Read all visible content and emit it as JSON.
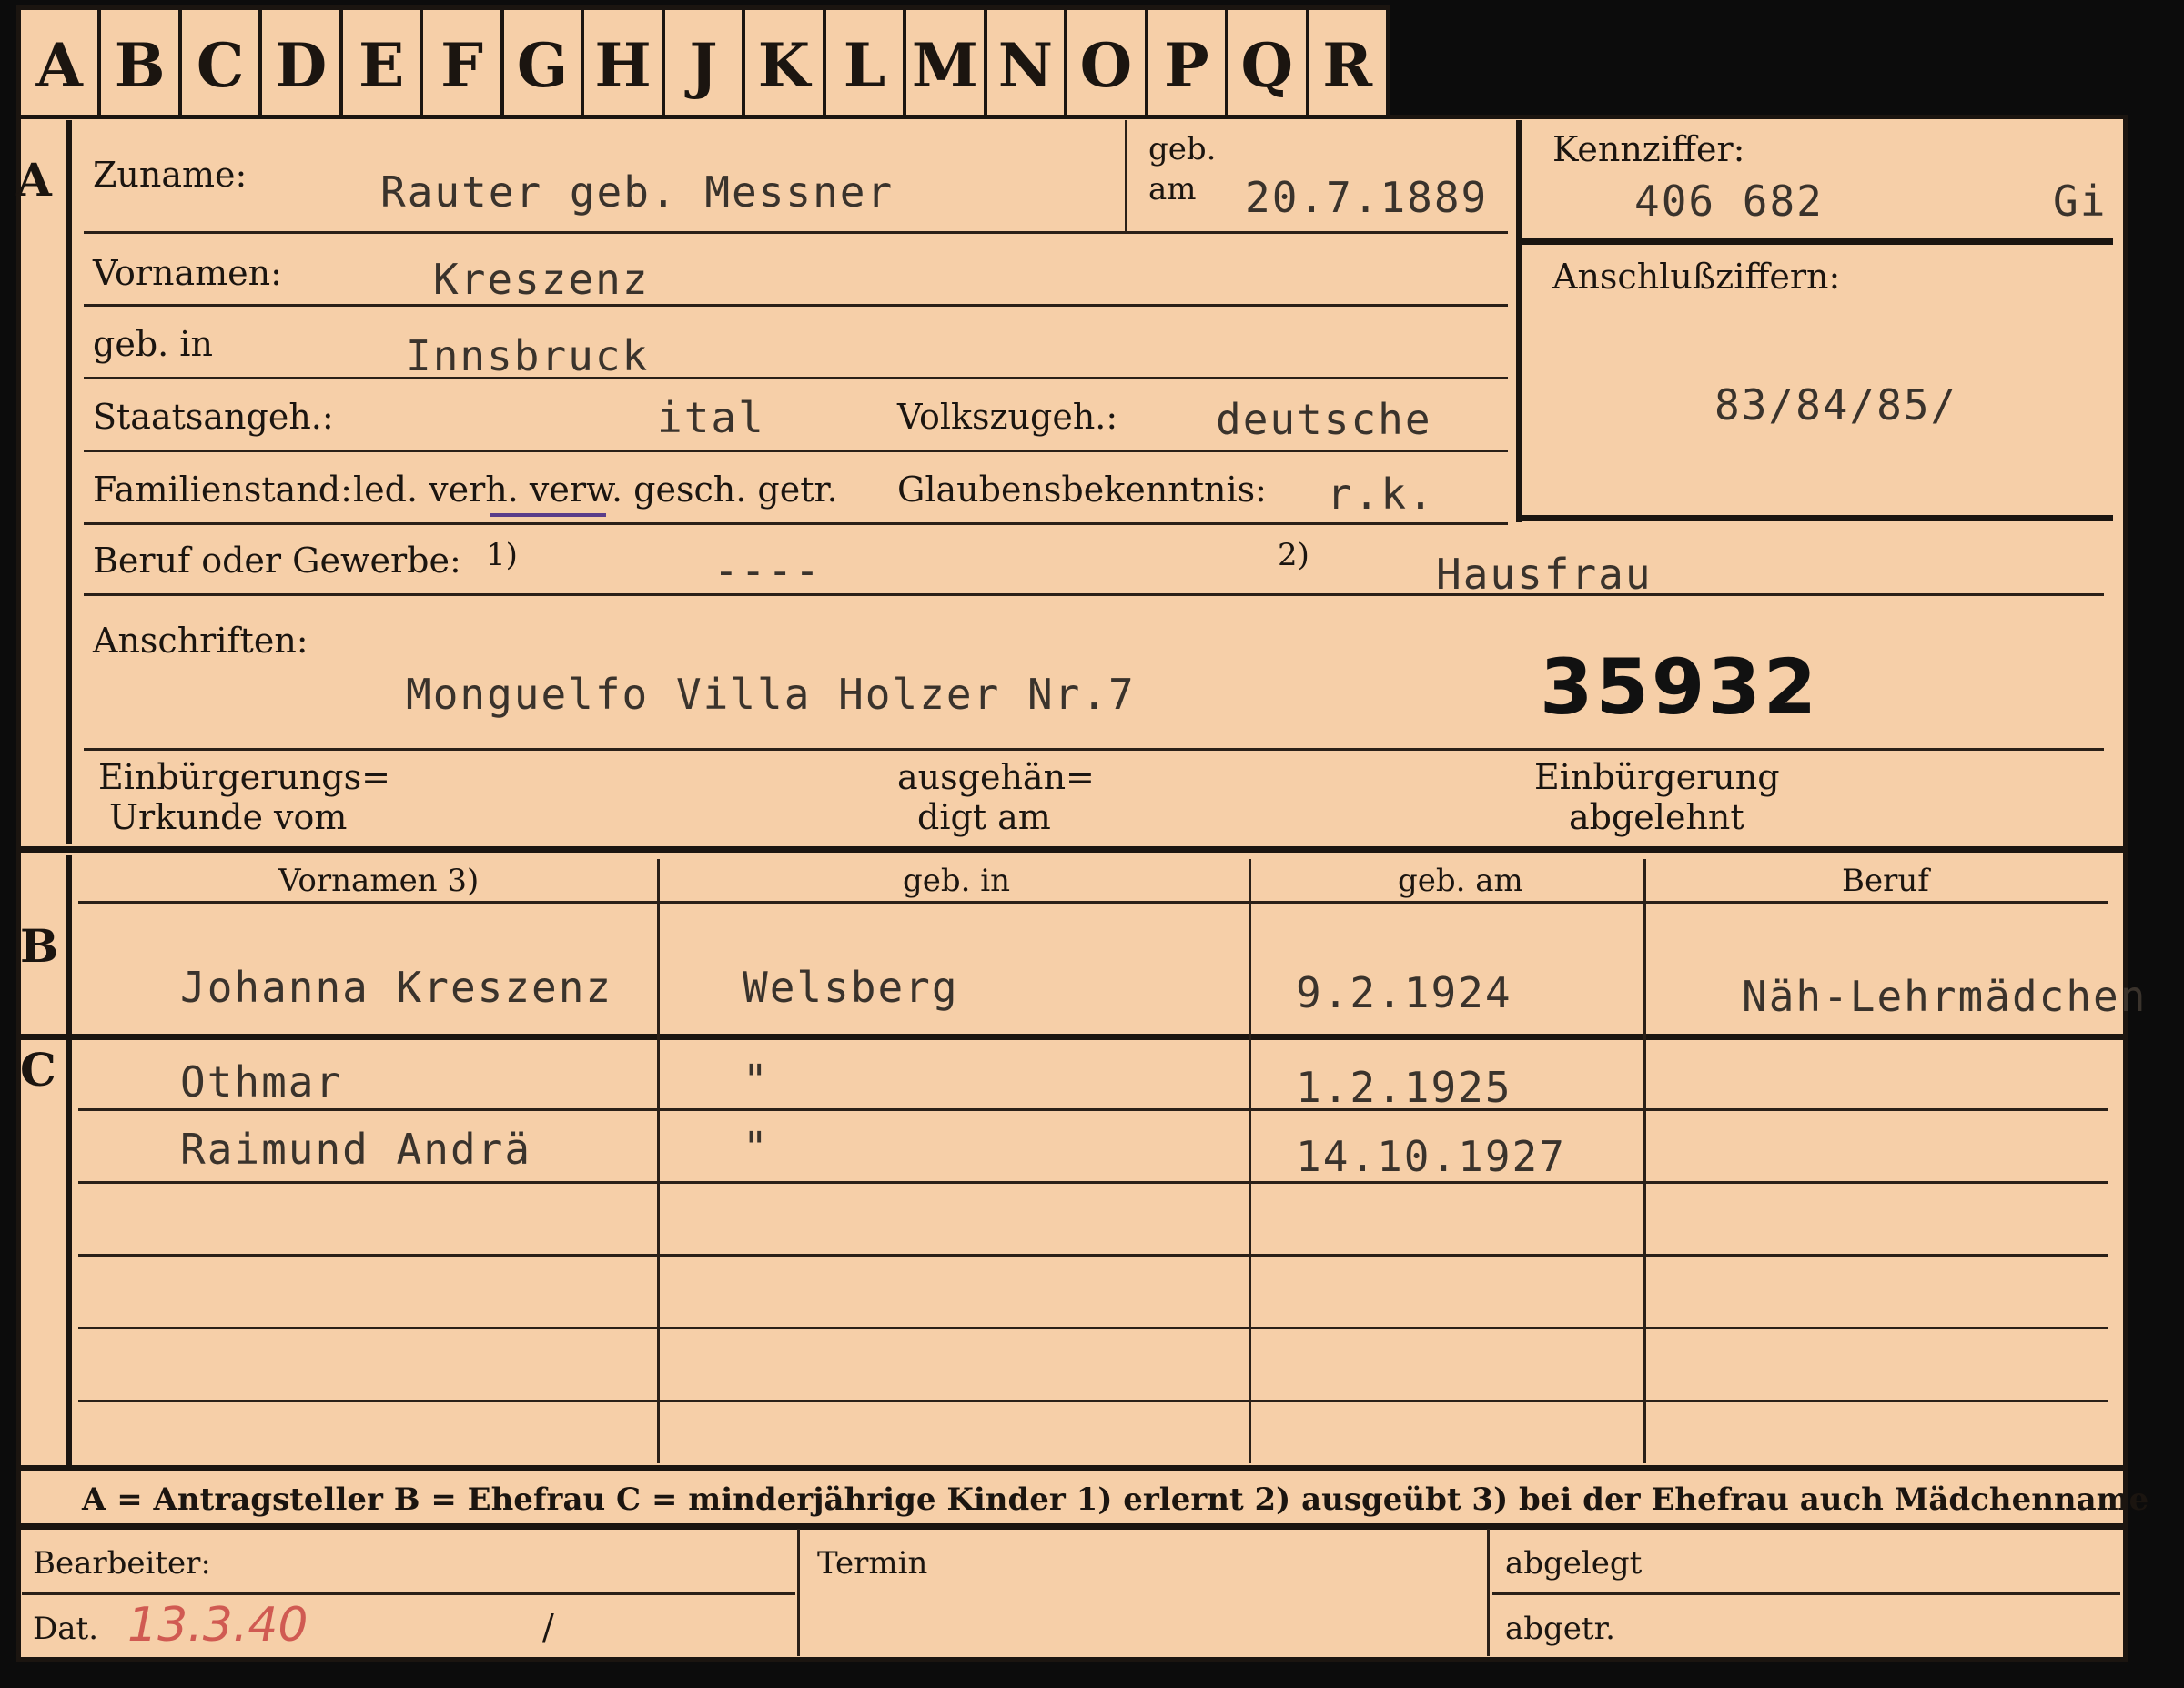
{
  "tabs": [
    "A",
    "B",
    "C",
    "D",
    "E",
    "F",
    "G",
    "H",
    "J",
    "K",
    "L",
    "M",
    "N",
    "O",
    "P",
    "Q",
    "R"
  ],
  "section_a": {
    "marker": "A",
    "zuname_label": "Zuname:",
    "zuname": "Rauter geb. Messner",
    "geb_am_label1": "geb.",
    "geb_am_label2": "am",
    "geb_am": "20.7.1889",
    "kennziffer_label": "Kennziffer:",
    "kennziffer": "406 682",
    "kennziffer_suffix": "Gi",
    "anschluss_label": "Anschlußziffern:",
    "anschluss": "83/84/85/",
    "vornamen_label": "Vornamen:",
    "vornamen": "Kreszenz",
    "geb_in_label": "geb. in",
    "geb_in": "Innsbruck",
    "staatsangeh_label": "Staatsangeh.:",
    "staatsangeh": "ital",
    "volkszugeh_label": "Volkszugeh.:",
    "volkszugeh": "deutsche",
    "familienstand_label": "Familienstand:",
    "familienstand_options": "led. verh. verw. gesch. getr.",
    "glaubens_label": "Glaubensbekenntnis:",
    "glaubens": "r.k.",
    "beruf_label": "Beruf oder Gewerbe:",
    "beruf_fn1": "1)",
    "beruf_1": "----",
    "beruf_fn2": "2)",
    "beruf_2": "Hausfrau",
    "anschriften_label": "Anschriften:",
    "anschrift": "Monguelfo Villa Holzer  Nr.7",
    "stamp_number": "35932",
    "einb_urkunde_l1": "Einbürgerungs=",
    "einb_urkunde_l2": "Urkunde vom",
    "ausgehaend_l1": "ausgehän=",
    "ausgehaend_l2": "digt am",
    "einb_abgelehnt_l1": "Einbürgerung",
    "einb_abgelehnt_l2": "abgelehnt"
  },
  "table": {
    "headers": [
      "Vornamen 3)",
      "geb. in",
      "geb. am",
      "Beruf"
    ],
    "section_b_marker": "B",
    "section_c_marker": "C",
    "b_row": {
      "vornamen": "Johanna Kreszenz",
      "geb_in": "Welsberg",
      "geb_am": "9.2.1924",
      "beruf": "Näh-Lehrmädchen"
    },
    "c_rows": [
      {
        "vornamen": "Othmar",
        "geb_in": "\"",
        "geb_am": "1.2.1925",
        "beruf": ""
      },
      {
        "vornamen": "Raimund Andrä",
        "geb_in": "\"",
        "geb_am": "14.10.1927",
        "beruf": ""
      }
    ]
  },
  "legend": "A = Antragsteller   B = Ehefrau   C = minderjährige Kinder   1) erlernt   2) ausgeübt   3) bei der Ehefrau auch Mädchenname",
  "footer": {
    "bearbeiter_label": "Bearbeiter:",
    "dat_label": "Dat.",
    "dat_value": "13.3.40",
    "slash": "/",
    "termin_label": "Termin",
    "abgelegt_label": "abgelegt",
    "abgetr_label": "abgetr."
  }
}
